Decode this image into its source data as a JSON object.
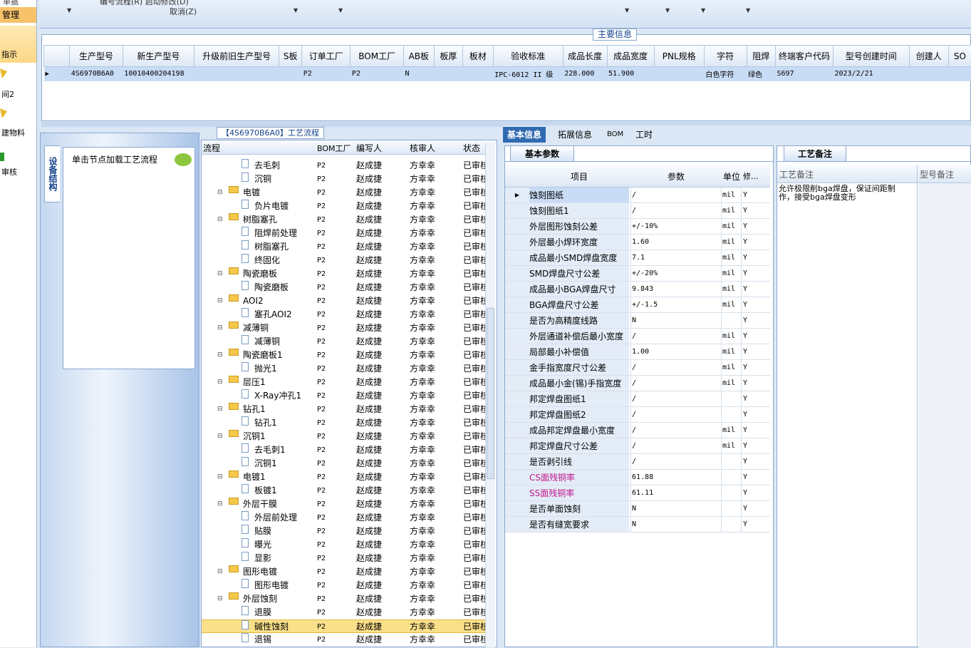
{
  "left_nav": {
    "items": [
      "单据",
      "管理",
      "指示",
      "间2",
      "建物料",
      "审核"
    ]
  },
  "toolbar": {
    "line1": "编号流程(R)    启动修改(D)",
    "cancel": "取消(Z)"
  },
  "main_info": {
    "title": "主要信息",
    "columns": [
      "生产型号",
      "新生产型号",
      "升级前旧生产型号",
      "S板",
      "订单工厂",
      "BOM工厂",
      "AB板",
      "板厚",
      "板材",
      "验收标准",
      "成品长度",
      "成品宽度",
      "PNL规格",
      "字符",
      "阻焊",
      "终端客户代码",
      "型号创建时间",
      "创建人",
      "SO"
    ],
    "row": [
      "4S6970B6A0",
      "10010400204198",
      "",
      "",
      "P2",
      "P2",
      "N",
      "",
      "",
      "IPC-6012 II 级",
      "228.000",
      "51.900",
      "",
      "白色字符",
      "绿色",
      "S697",
      "2023/2/21",
      "",
      ""
    ]
  },
  "process_panel": {
    "title": "【4S6970B6A0】工艺流程",
    "vertical_tab": "设备结构",
    "load_hint": "单击节点加载工艺流程",
    "columns": [
      "流程",
      "BOM工厂",
      "编写人",
      "核审人",
      "状态"
    ],
    "rows": [
      {
        "name": "去毛刺",
        "level": 2,
        "factory": "P2",
        "writer": "赵成捷",
        "reviewer": "方幸幸",
        "status": "已审核"
      },
      {
        "name": "沉铜",
        "level": 2,
        "factory": "P2",
        "writer": "赵成捷",
        "reviewer": "方幸幸",
        "status": "已审核"
      },
      {
        "name": "电镀",
        "level": 1,
        "factory": "P2",
        "writer": "赵成捷",
        "reviewer": "方幸幸",
        "status": "已审核"
      },
      {
        "name": "负片电镀",
        "level": 2,
        "factory": "P2",
        "writer": "赵成捷",
        "reviewer": "方幸幸",
        "status": "已审核"
      },
      {
        "name": "树脂塞孔",
        "level": 1,
        "factory": "P2",
        "writer": "赵成捷",
        "reviewer": "方幸幸",
        "status": "已审核"
      },
      {
        "name": "阻焊前处理",
        "level": 2,
        "factory": "P2",
        "writer": "赵成捷",
        "reviewer": "方幸幸",
        "status": "已审核"
      },
      {
        "name": "树脂塞孔",
        "level": 2,
        "factory": "P2",
        "writer": "赵成捷",
        "reviewer": "方幸幸",
        "status": "已审核"
      },
      {
        "name": "终固化",
        "level": 2,
        "factory": "P2",
        "writer": "赵成捷",
        "reviewer": "方幸幸",
        "status": "已审核"
      },
      {
        "name": "陶瓷磨板",
        "level": 1,
        "factory": "P2",
        "writer": "赵成捷",
        "reviewer": "方幸幸",
        "status": "已审核"
      },
      {
        "name": "陶瓷磨板",
        "level": 2,
        "factory": "P2",
        "writer": "赵成捷",
        "reviewer": "方幸幸",
        "status": "已审核"
      },
      {
        "name": "AOI2",
        "level": 1,
        "factory": "P2",
        "writer": "赵成捷",
        "reviewer": "方幸幸",
        "status": "已审核"
      },
      {
        "name": "塞孔AOI2",
        "level": 2,
        "factory": "P2",
        "writer": "赵成捷",
        "reviewer": "方幸幸",
        "status": "已审核"
      },
      {
        "name": "减薄铜",
        "level": 1,
        "factory": "P2",
        "writer": "赵成捷",
        "reviewer": "方幸幸",
        "status": "已审核"
      },
      {
        "name": "减薄铜",
        "level": 2,
        "factory": "P2",
        "writer": "赵成捷",
        "reviewer": "方幸幸",
        "status": "已审核"
      },
      {
        "name": "陶瓷磨板1",
        "level": 1,
        "factory": "P2",
        "writer": "赵成捷",
        "reviewer": "方幸幸",
        "status": "已审核"
      },
      {
        "name": "抛光1",
        "level": 2,
        "factory": "P2",
        "writer": "赵成捷",
        "reviewer": "方幸幸",
        "status": "已审核"
      },
      {
        "name": "层压1",
        "level": 1,
        "factory": "P2",
        "writer": "赵成捷",
        "reviewer": "方幸幸",
        "status": "已审核"
      },
      {
        "name": "X-Ray冲孔1",
        "level": 2,
        "factory": "P2",
        "writer": "赵成捷",
        "reviewer": "方幸幸",
        "status": "已审核"
      },
      {
        "name": "钻孔1",
        "level": 1,
        "factory": "P2",
        "writer": "赵成捷",
        "reviewer": "方幸幸",
        "status": "已审核"
      },
      {
        "name": "钻孔1",
        "level": 2,
        "factory": "P2",
        "writer": "赵成捷",
        "reviewer": "方幸幸",
        "status": "已审核"
      },
      {
        "name": "沉铜1",
        "level": 1,
        "factory": "P2",
        "writer": "赵成捷",
        "reviewer": "方幸幸",
        "status": "已审核"
      },
      {
        "name": "去毛刺1",
        "level": 2,
        "factory": "P2",
        "writer": "赵成捷",
        "reviewer": "方幸幸",
        "status": "已审核"
      },
      {
        "name": "沉铜1",
        "level": 2,
        "factory": "P2",
        "writer": "赵成捷",
        "reviewer": "方幸幸",
        "status": "已审核"
      },
      {
        "name": "电镀1",
        "level": 1,
        "factory": "P2",
        "writer": "赵成捷",
        "reviewer": "方幸幸",
        "status": "已审核"
      },
      {
        "name": "板镀1",
        "level": 2,
        "factory": "P2",
        "writer": "赵成捷",
        "reviewer": "方幸幸",
        "status": "已审核"
      },
      {
        "name": "外层干膜",
        "level": 1,
        "factory": "P2",
        "writer": "赵成捷",
        "reviewer": "方幸幸",
        "status": "已审核"
      },
      {
        "name": "外层前处理",
        "level": 2,
        "factory": "P2",
        "writer": "赵成捷",
        "reviewer": "方幸幸",
        "status": "已审核"
      },
      {
        "name": "贴膜",
        "level": 2,
        "factory": "P2",
        "writer": "赵成捷",
        "reviewer": "方幸幸",
        "status": "已审核"
      },
      {
        "name": "曝光",
        "level": 2,
        "factory": "P2",
        "writer": "赵成捷",
        "reviewer": "方幸幸",
        "status": "已审核"
      },
      {
        "name": "显影",
        "level": 2,
        "factory": "P2",
        "writer": "赵成捷",
        "reviewer": "方幸幸",
        "status": "已审核"
      },
      {
        "name": "图形电镀",
        "level": 1,
        "factory": "P2",
        "writer": "赵成捷",
        "reviewer": "方幸幸",
        "status": "已审核"
      },
      {
        "name": "图形电镀",
        "level": 2,
        "factory": "P2",
        "writer": "赵成捷",
        "reviewer": "方幸幸",
        "status": "已审核"
      },
      {
        "name": "外层蚀刻",
        "level": 1,
        "factory": "P2",
        "writer": "赵成捷",
        "reviewer": "方幸幸",
        "status": "已审核"
      },
      {
        "name": "退膜",
        "level": 2,
        "factory": "P2",
        "writer": "赵成捷",
        "reviewer": "方幸幸",
        "status": "已审核"
      },
      {
        "name": "碱性蚀刻",
        "level": 2,
        "factory": "P2",
        "writer": "赵成捷",
        "reviewer": "方幸幸",
        "status": "已审核",
        "selected": true
      },
      {
        "name": "退锡",
        "level": 2,
        "factory": "P2",
        "writer": "赵成捷",
        "reviewer": "方幸幸",
        "status": "已审核"
      }
    ]
  },
  "right_tabs": [
    "基本信息",
    "拓展信息",
    "BOM",
    "工时"
  ],
  "params": {
    "group_title": "基本参数",
    "columns": [
      "项目",
      "参数",
      "单位",
      "修..."
    ],
    "rows": [
      {
        "item": "蚀刻图纸",
        "value": "/",
        "unit": "mil",
        "mod": "Y",
        "selected": true
      },
      {
        "item": "蚀刻图纸1",
        "value": "/",
        "unit": "mil",
        "mod": "Y"
      },
      {
        "item": "外层图形蚀刻公差",
        "value": "+/-10%",
        "unit": "mil",
        "mod": "Y"
      },
      {
        "item": "外层最小焊环宽度",
        "value": "1.60",
        "unit": "mil",
        "mod": "Y"
      },
      {
        "item": "成品最小SMD焊盘宽度",
        "value": "7.1",
        "unit": "mil",
        "mod": "Y"
      },
      {
        "item": "SMD焊盘尺寸公差",
        "value": "+/-20%",
        "unit": "mil",
        "mod": "Y"
      },
      {
        "item": "成品最小BGA焊盘尺寸",
        "value": "9.843",
        "unit": "mil",
        "mod": "Y"
      },
      {
        "item": "BGA焊盘尺寸公差",
        "value": "+/-1.5",
        "unit": "mil",
        "mod": "Y"
      },
      {
        "item": "是否为高精度线路",
        "value": "N",
        "unit": "",
        "mod": "Y"
      },
      {
        "item": "外层通道补偿后最小宽度",
        "value": "/",
        "unit": "mil",
        "mod": "Y"
      },
      {
        "item": "局部最小补偿值",
        "value": "1.00",
        "unit": "mil",
        "mod": "Y"
      },
      {
        "item": "金手指宽度尺寸公差",
        "value": "/",
        "unit": "mil",
        "mod": "Y"
      },
      {
        "item": "成品最小金(锡)手指宽度",
        "value": "/",
        "unit": "mil",
        "mod": "Y"
      },
      {
        "item": "邦定焊盘图纸1",
        "value": "/",
        "unit": "",
        "mod": "Y"
      },
      {
        "item": "邦定焊盘图纸2",
        "value": "/",
        "unit": "",
        "mod": "Y"
      },
      {
        "item": "成品邦定焊盘最小宽度",
        "value": "/",
        "unit": "mil",
        "mod": "Y"
      },
      {
        "item": "邦定焊盘尺寸公差",
        "value": "/",
        "unit": "mil",
        "mod": "Y"
      },
      {
        "item": "是否剥引线",
        "value": "/",
        "unit": "",
        "mod": "Y"
      },
      {
        "item": "CS面残铜率",
        "value": "61.88",
        "unit": "",
        "mod": "Y",
        "pink": true
      },
      {
        "item": "SS面残铜率",
        "value": "61.11",
        "unit": "",
        "mod": "Y",
        "pink": true
      },
      {
        "item": "是否单面蚀刻",
        "value": "N",
        "unit": "",
        "mod": "Y"
      },
      {
        "item": "是否有缝宽要求",
        "value": "N",
        "unit": "",
        "mod": "Y"
      }
    ]
  },
  "notes": {
    "group_title": "工艺备注",
    "col1": "工艺备注",
    "col2": "型号备注",
    "text": "允许极限削bga焊盘，保证间距制作，接受bga焊盘变形"
  }
}
